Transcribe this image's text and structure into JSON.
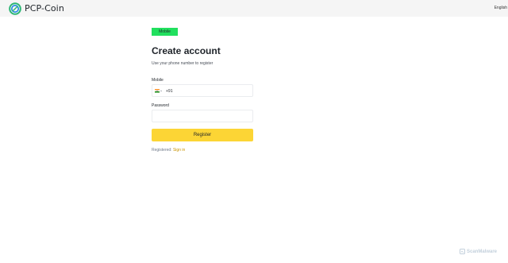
{
  "header": {
    "brand": "PCP-Coin",
    "language": "English"
  },
  "tabs": {
    "mobile_label": "Mobile"
  },
  "form": {
    "title": "Create account",
    "subtitle": "Use your phone number to register",
    "mobile_label": "Mobile",
    "country_code": "+91",
    "country_flag": "India",
    "mobile_value": "",
    "password_label": "Password",
    "password_value": "",
    "register_label": "Register",
    "registered_text": "Registered: ",
    "signin_label": "Sign in"
  },
  "watermark": {
    "text": "ScanMalware"
  },
  "colors": {
    "accent_green": "#21e05e",
    "button_yellow": "#fcd535",
    "link_gold": "#c99400",
    "topbar_bg": "#f5f5f5"
  },
  "icons": {
    "logo": "pcp-coin-logo-icon",
    "flag": "india-flag-icon",
    "caret": "caret-down-icon",
    "watermark": "scanmalware-logo-icon"
  }
}
